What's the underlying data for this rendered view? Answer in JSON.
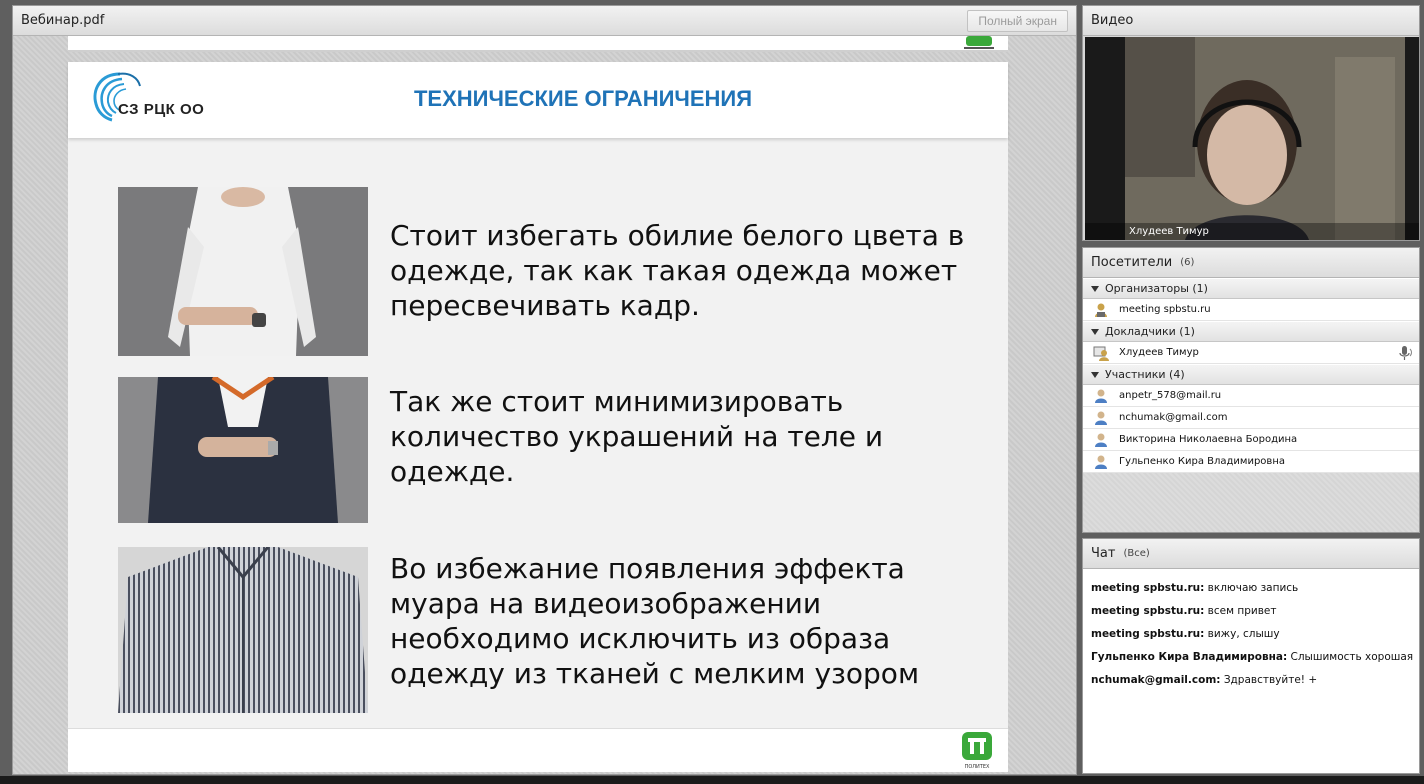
{
  "presentation": {
    "title": "Вебинар.pdf",
    "fullscreen_label": "Полный экран",
    "slide": {
      "logo_text": "СЗ РЦК ОО",
      "title": "ТЕХНИЧЕСКИЕ ОГРАНИЧЕНИЯ",
      "paragraphs": [
        "Стоит избегать обилие белого цвета в одежде, так как такая одежда может пересвечивать кадр.",
        "Так же стоит минимизировать количество украшений на теле и одежде.",
        "Во избежание появления эффекта муара на видеоизображении необходимо исключить из образа одежду из тканей с мелким узором"
      ],
      "footer_logo_text": "ПОЛИТЕХ"
    }
  },
  "video": {
    "title": "Видео",
    "presenter_name": "Хлудеев Тимур"
  },
  "attendees": {
    "title": "Посетители",
    "count": "(6)",
    "groups": [
      {
        "label": "Организаторы (1)",
        "members": [
          "meeting spbstu.ru"
        ]
      },
      {
        "label": "Докладчики (1)",
        "members": [
          "Хлудеев Тимур"
        ]
      },
      {
        "label": "Участники (4)",
        "members": [
          "anpetr_578@mail.ru",
          "nchumak@gmail.com",
          "Викторина Николаевна Бородина",
          "Гульпенко Кира Владимировна"
        ]
      }
    ]
  },
  "chat": {
    "title": "Чат",
    "scope": "(Все)",
    "messages": [
      {
        "user": "meeting spbstu.ru:",
        "text": "включаю запись"
      },
      {
        "user": "meeting spbstu.ru:",
        "text": "всем привет"
      },
      {
        "user": "meeting spbstu.ru:",
        "text": "вижу, слышу"
      },
      {
        "user": "Гульпенко Кира Владимировна:",
        "text": "Слышимость хорошая"
      },
      {
        "user": "nchumak@gmail.com:",
        "text": "Здравствуйте! +"
      }
    ]
  },
  "colors": {
    "title_blue": "#1f73b7",
    "logo_green": "#3aa83a"
  }
}
